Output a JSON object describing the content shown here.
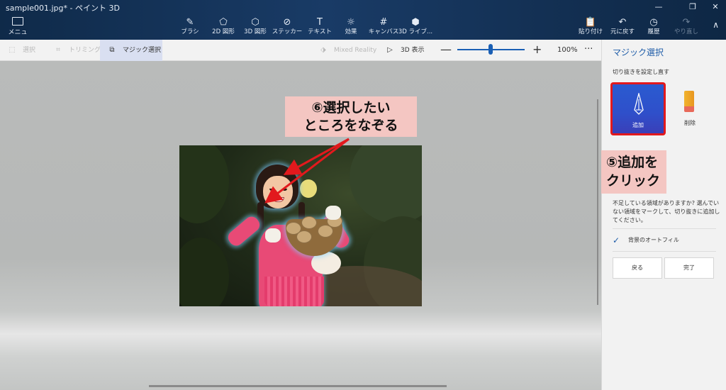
{
  "window": {
    "title": "sample001.jpg* - ペイント 3D",
    "controls": {
      "minimize": "—",
      "maximize": "❐",
      "close": "✕"
    }
  },
  "ribbon": {
    "menu_label": "メニュー",
    "tools": [
      {
        "label": "ブラシ",
        "icon": "brush-icon",
        "glyph": "✎"
      },
      {
        "label": "2D 図形",
        "icon": "2d-shapes-icon",
        "glyph": "⬠"
      },
      {
        "label": "3D 図形",
        "icon": "3d-shapes-icon",
        "glyph": "⬡"
      },
      {
        "label": "ステッカー",
        "icon": "sticker-icon",
        "glyph": "⊘"
      },
      {
        "label": "テキスト",
        "icon": "text-icon",
        "glyph": "T"
      },
      {
        "label": "効果",
        "icon": "effects-icon",
        "glyph": "☼"
      },
      {
        "label": "キャンバス",
        "icon": "canvas-icon",
        "glyph": "#"
      },
      {
        "label": "3D ライブ...",
        "icon": "3d-library-icon",
        "glyph": "⬢"
      }
    ],
    "right_tools": [
      {
        "label": "貼り付け",
        "icon": "paste-icon",
        "glyph": "📋",
        "enabled": true
      },
      {
        "label": "元に戻す",
        "icon": "undo-icon",
        "glyph": "↶",
        "enabled": true
      },
      {
        "label": "履歴",
        "icon": "history-icon",
        "glyph": "◷",
        "enabled": true
      },
      {
        "label": "やり直し",
        "icon": "redo-icon",
        "glyph": "↷",
        "enabled": false
      }
    ],
    "collapse_glyph": "∧"
  },
  "toolbar": {
    "select_label": "選択",
    "crop_label": "トリミング",
    "magic_select_label": "マジック選択",
    "mixed_reality_label": "Mixed Reality",
    "view3d_label": "3D 表示",
    "zoom_minus": "—",
    "zoom_plus": "+",
    "zoom_value": "100%",
    "zoom_fraction": 0.5,
    "more": "···"
  },
  "annotations": {
    "callout_canvas_line1": "⑥選択したい",
    "callout_canvas_line2": "ところをなぞる",
    "callout_panel_line1": "⑤追加を",
    "callout_panel_line2": "クリック"
  },
  "panel": {
    "title": "マジック選択",
    "subtitle": "切り抜きを設定し直す",
    "add_label": "追加",
    "remove_label": "削除",
    "description": "不足している領域がありますか? 選んでいない領域をマークして、切り抜きに追加してください。",
    "autofill_label": "背景のオートフィル",
    "autofill_checked": true,
    "back_label": "戻る",
    "done_label": "完了"
  },
  "colors": {
    "accent": "#1e5ca8",
    "callout_bg": "#f4c6c2",
    "highlight_border": "#e2191d",
    "arrow": "#e2191d"
  }
}
